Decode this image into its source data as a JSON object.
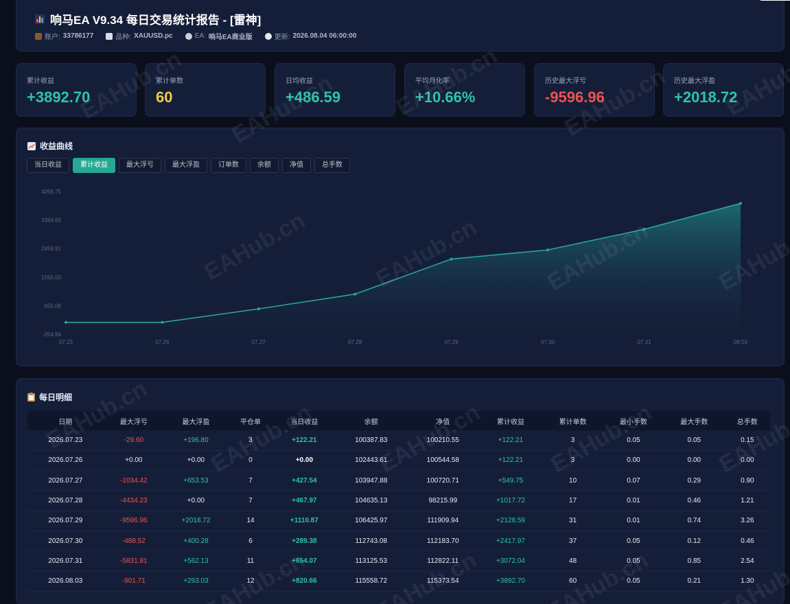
{
  "header": {
    "title": "响马EA V9.34 每日交易统计报告 - [雷神]",
    "account_label": "账户:",
    "account_value": "33786177",
    "symbol_label": "品种:",
    "symbol_value": "XAUUSD.pc",
    "ea_label": "EA:",
    "ea_value": "响马EA商业版",
    "update_label": "更新:",
    "update_value": "2026.08.04 06:00:00"
  },
  "stats": [
    {
      "label": "累计收益",
      "value": "+3892.70",
      "color": "#2ec4a8"
    },
    {
      "label": "累计单数",
      "value": "60",
      "color": "#f3c94a"
    },
    {
      "label": "日均收益",
      "value": "+486.59",
      "color": "#2ec4a8"
    },
    {
      "label": "平均月化率",
      "value": "+10.66%",
      "color": "#2ec4a8"
    },
    {
      "label": "历史最大浮亏",
      "value": "-9596.96",
      "color": "#f0524f"
    },
    {
      "label": "历史最大浮盈",
      "value": "+2018.72",
      "color": "#2ec4a8"
    }
  ],
  "chart_section": {
    "title": "收益曲线",
    "tabs": [
      "当日收益",
      "累计收益",
      "最大浮亏",
      "最大浮盈",
      "订单数",
      "余额",
      "净值",
      "总手数"
    ],
    "active_tab": 1
  },
  "chart_data": {
    "type": "area",
    "x": [
      "07.23",
      "07.26",
      "07.27",
      "07.28",
      "07.29",
      "07.30",
      "07.31",
      "08.03"
    ],
    "series": [
      {
        "values": [
          122.21,
          122.21,
          549.75,
          1017.72,
          2128.59,
          2417.97,
          3072.04,
          3892.7
        ]
      }
    ],
    "y_ticks": [
      "4269.75",
      "3364.83",
      "2459.91",
      "1555.00",
      "650.08",
      "-254.84"
    ],
    "ylim": [
      -254.84,
      4269.75
    ],
    "grid": false,
    "line_color": "#2ba59a"
  },
  "table": {
    "title": "每日明细",
    "headers": [
      "日期",
      "最大浮亏",
      "最大浮盈",
      "平仓单",
      "当日收益",
      "余额",
      "净值",
      "累计收益",
      "累计单数",
      "最小手数",
      "最大手数",
      "总手数"
    ],
    "rows": [
      [
        "2026.07.23",
        "-29.60",
        "+196.80",
        "3",
        "+122.21",
        "100387.83",
        "100210.55",
        "+122.21",
        "3",
        "0.05",
        "0.05",
        "0.15"
      ],
      [
        "2026.07.26",
        "+0.00",
        "+0.00",
        "0",
        "+0.00",
        "102443.61",
        "100544.58",
        "+122.21",
        "3",
        "0.00",
        "0.00",
        "0.00"
      ],
      [
        "2026.07.27",
        "-1034.42",
        "+653.53",
        "7",
        "+427.54",
        "103947.88",
        "100720.71",
        "+549.75",
        "10",
        "0.07",
        "0.29",
        "0.90"
      ],
      [
        "2026.07.28",
        "-4434.23",
        "+0.00",
        "7",
        "+467.97",
        "104635.13",
        "98215.99",
        "+1017.72",
        "17",
        "0.01",
        "0.46",
        "1.21"
      ],
      [
        "2026.07.29",
        "-9596.96",
        "+2018.72",
        "14",
        "+1110.87",
        "106425.97",
        "111909.94",
        "+2128.59",
        "31",
        "0.01",
        "0.74",
        "3.26"
      ],
      [
        "2026.07.30",
        "-488.52",
        "+400.28",
        "6",
        "+289.38",
        "112743.08",
        "112183.70",
        "+2417.97",
        "37",
        "0.05",
        "0.12",
        "0.46"
      ],
      [
        "2026.07.31",
        "-5831.81",
        "+562.13",
        "11",
        "+654.07",
        "113125.53",
        "112822.11",
        "+3072.04",
        "48",
        "0.05",
        "0.85",
        "2.54"
      ],
      [
        "2026.08.03",
        "-901.71",
        "+293.03",
        "12",
        "+820.66",
        "115558.72",
        "115373.54",
        "+3892.70",
        "60",
        "0.05",
        "0.21",
        "1.30"
      ]
    ]
  },
  "watermark": "EAHub.cn"
}
